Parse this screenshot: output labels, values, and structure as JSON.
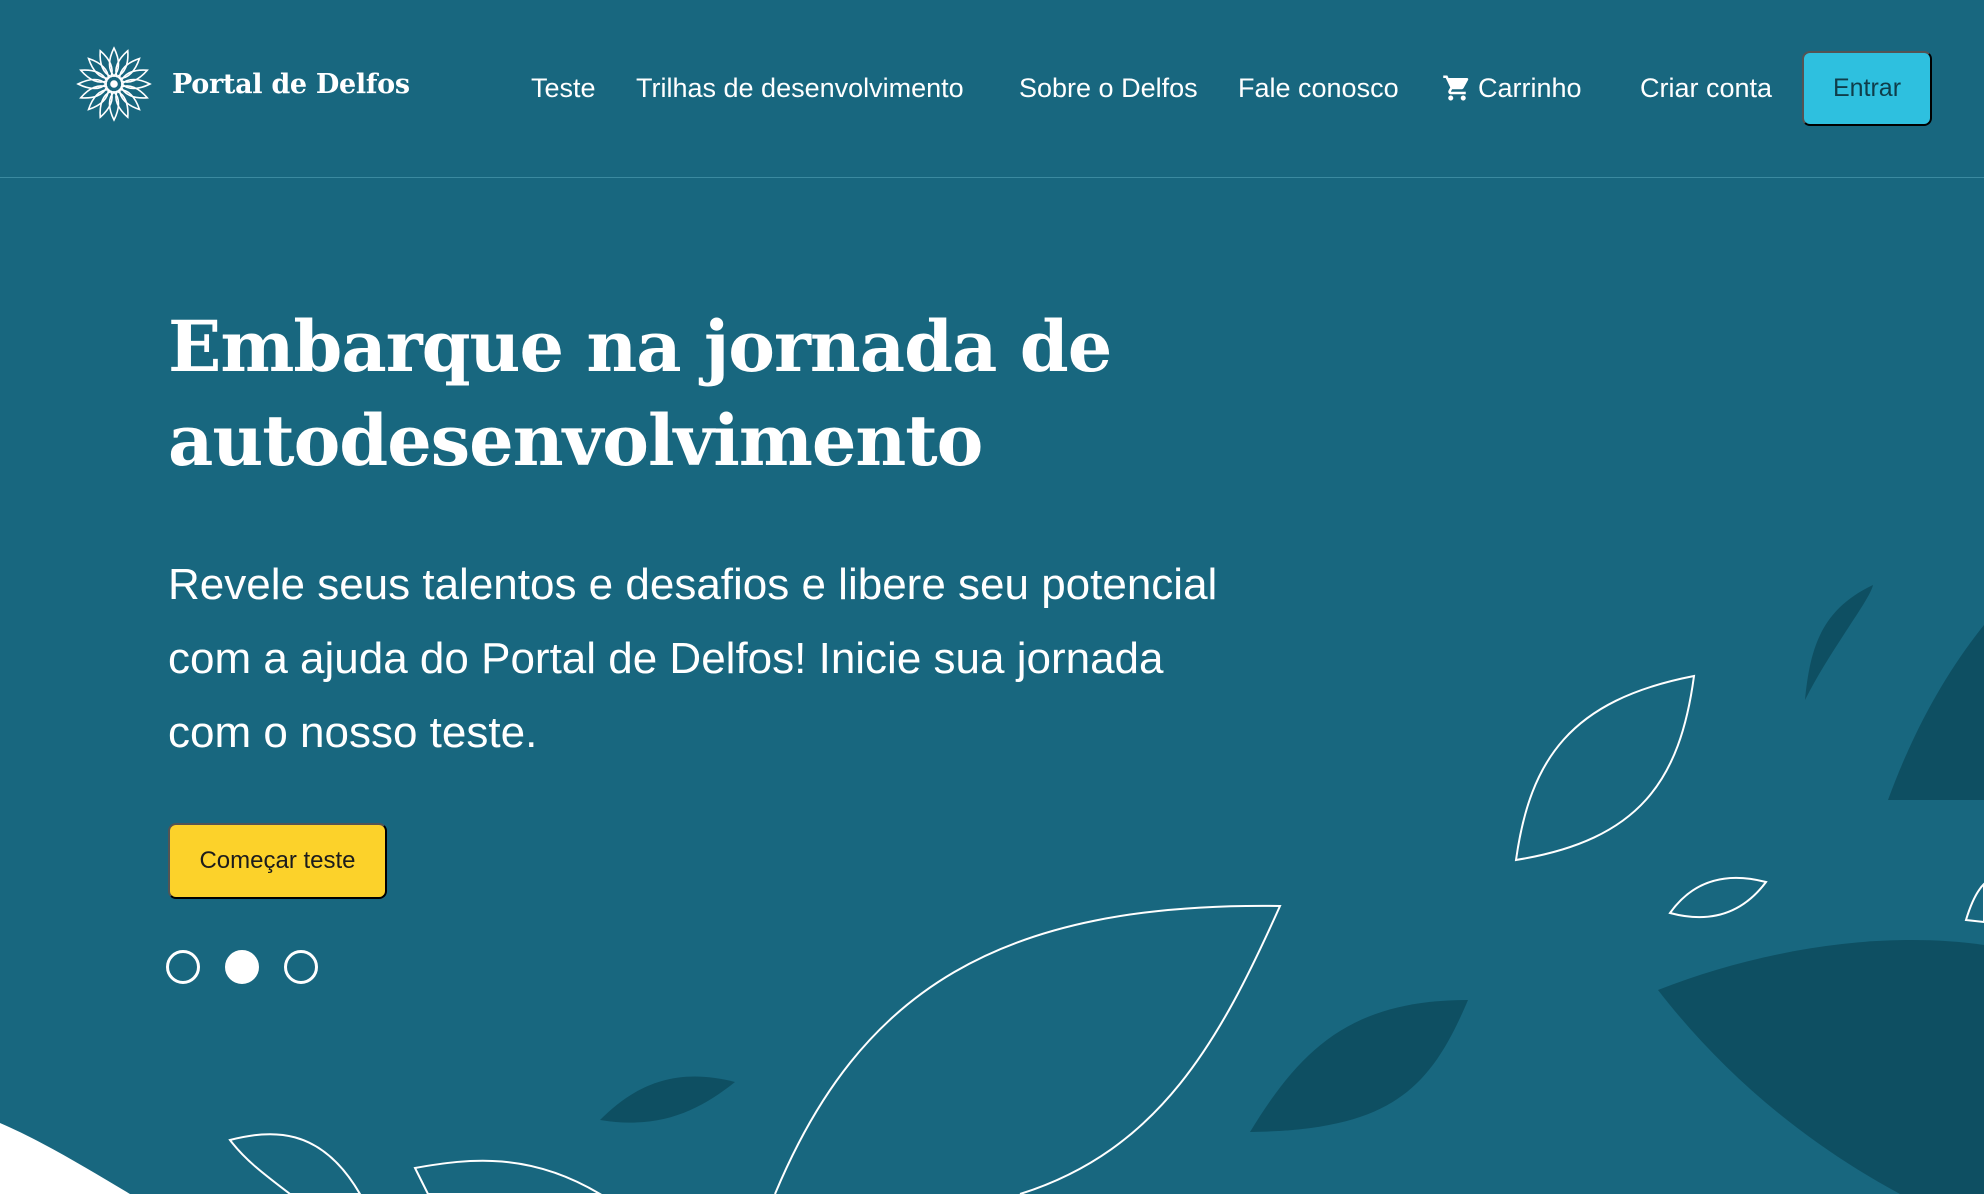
{
  "brand": {
    "name": "Portal de Delfos",
    "logo_icon": "mandala-flower-icon"
  },
  "nav": {
    "items": [
      {
        "label": "Teste"
      },
      {
        "label": "Trilhas de desenvolvimento"
      },
      {
        "label": "Sobre o Delfos"
      },
      {
        "label": "Fale conosco"
      },
      {
        "label": "Carrinho",
        "icon": "cart-icon"
      },
      {
        "label": "Criar conta"
      }
    ],
    "login_label": "Entrar"
  },
  "hero": {
    "title_line1": "Embarque na jornada de",
    "title_line2": "autodesenvolvimento",
    "subtitle_line1": "Revele seus talentos e desafios e libere seu potencial",
    "subtitle_line2": "com a ajuda do Portal de Delfos! Inicie sua jornada",
    "subtitle_line3": "com o nosso teste.",
    "cta_label": "Começar teste"
  },
  "carousel": {
    "slide_count": 3,
    "active_index": 1
  },
  "colors": {
    "background": "#18677f",
    "accent_button": "#2ec0df",
    "cta_button": "#fcd22a",
    "leaf_dark": "#0e4f62"
  }
}
